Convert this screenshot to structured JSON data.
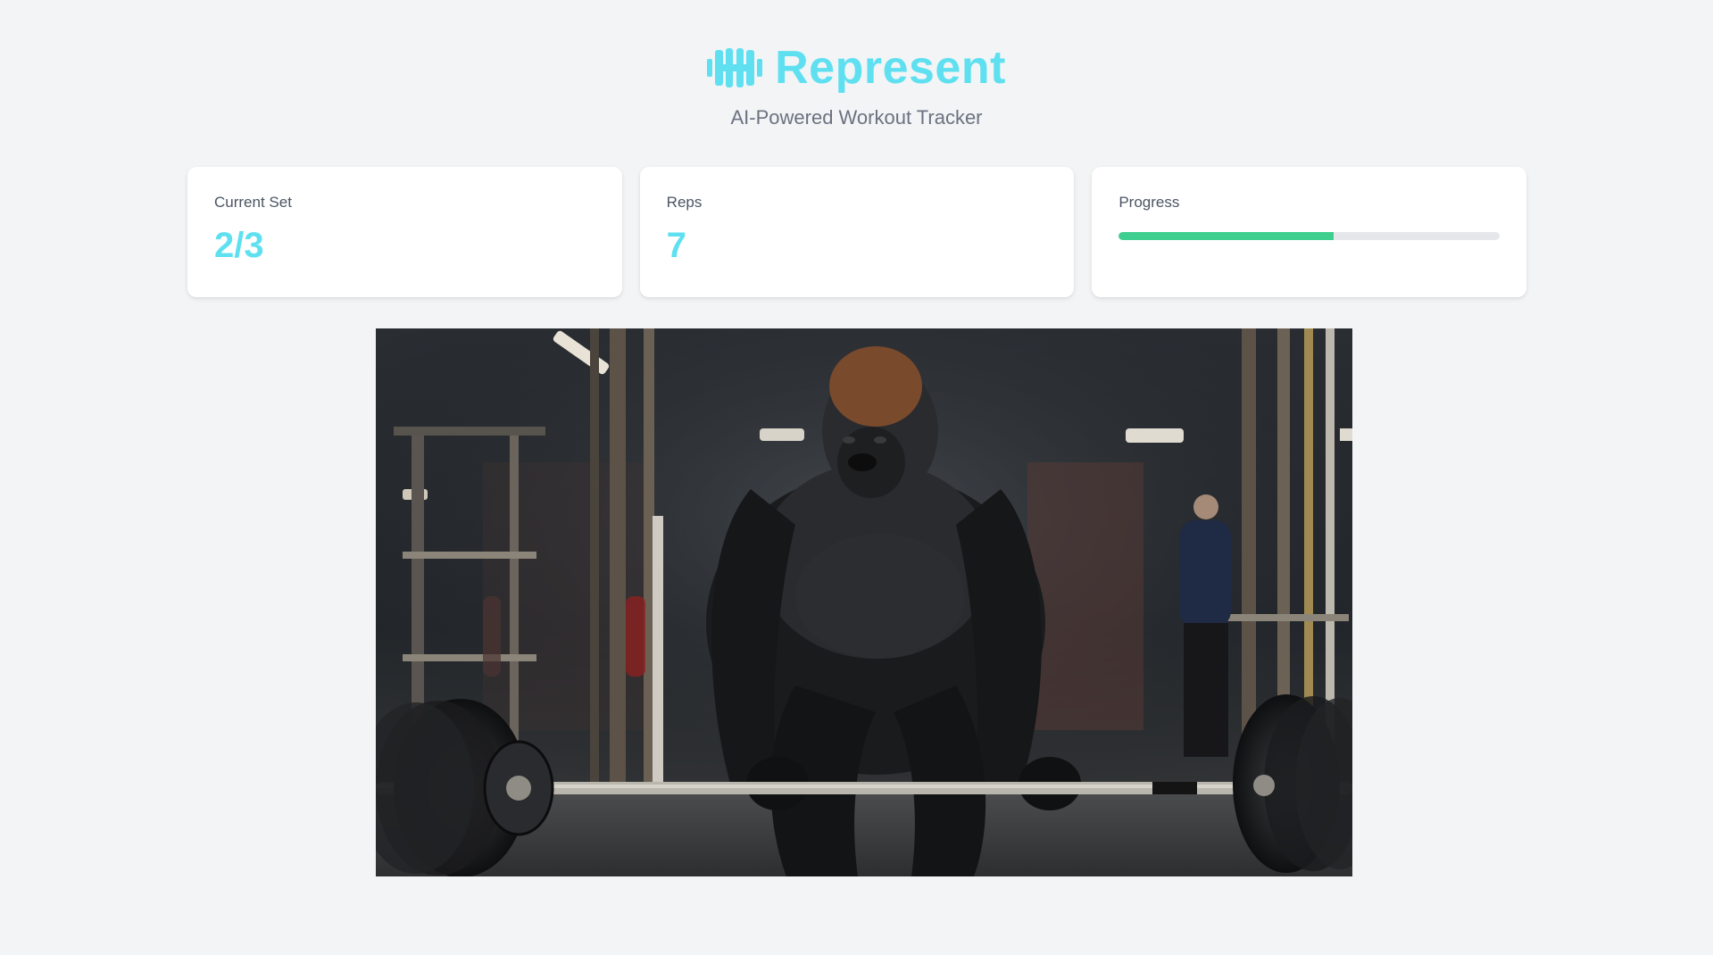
{
  "app": {
    "title": "Represent",
    "subtitle": "AI-Powered Workout Tracker",
    "logo_icon": "dumbbell-icon",
    "accent_color": "#5fe0f0"
  },
  "stats": {
    "current_set": {
      "label": "Current Set",
      "value": "2/3"
    },
    "reps": {
      "label": "Reps",
      "value": "7"
    },
    "progress": {
      "label": "Progress",
      "fraction": 0.565,
      "color": "#3ecf8e"
    }
  },
  "media": {
    "image_subject": "gorilla-deadlift-photo"
  }
}
